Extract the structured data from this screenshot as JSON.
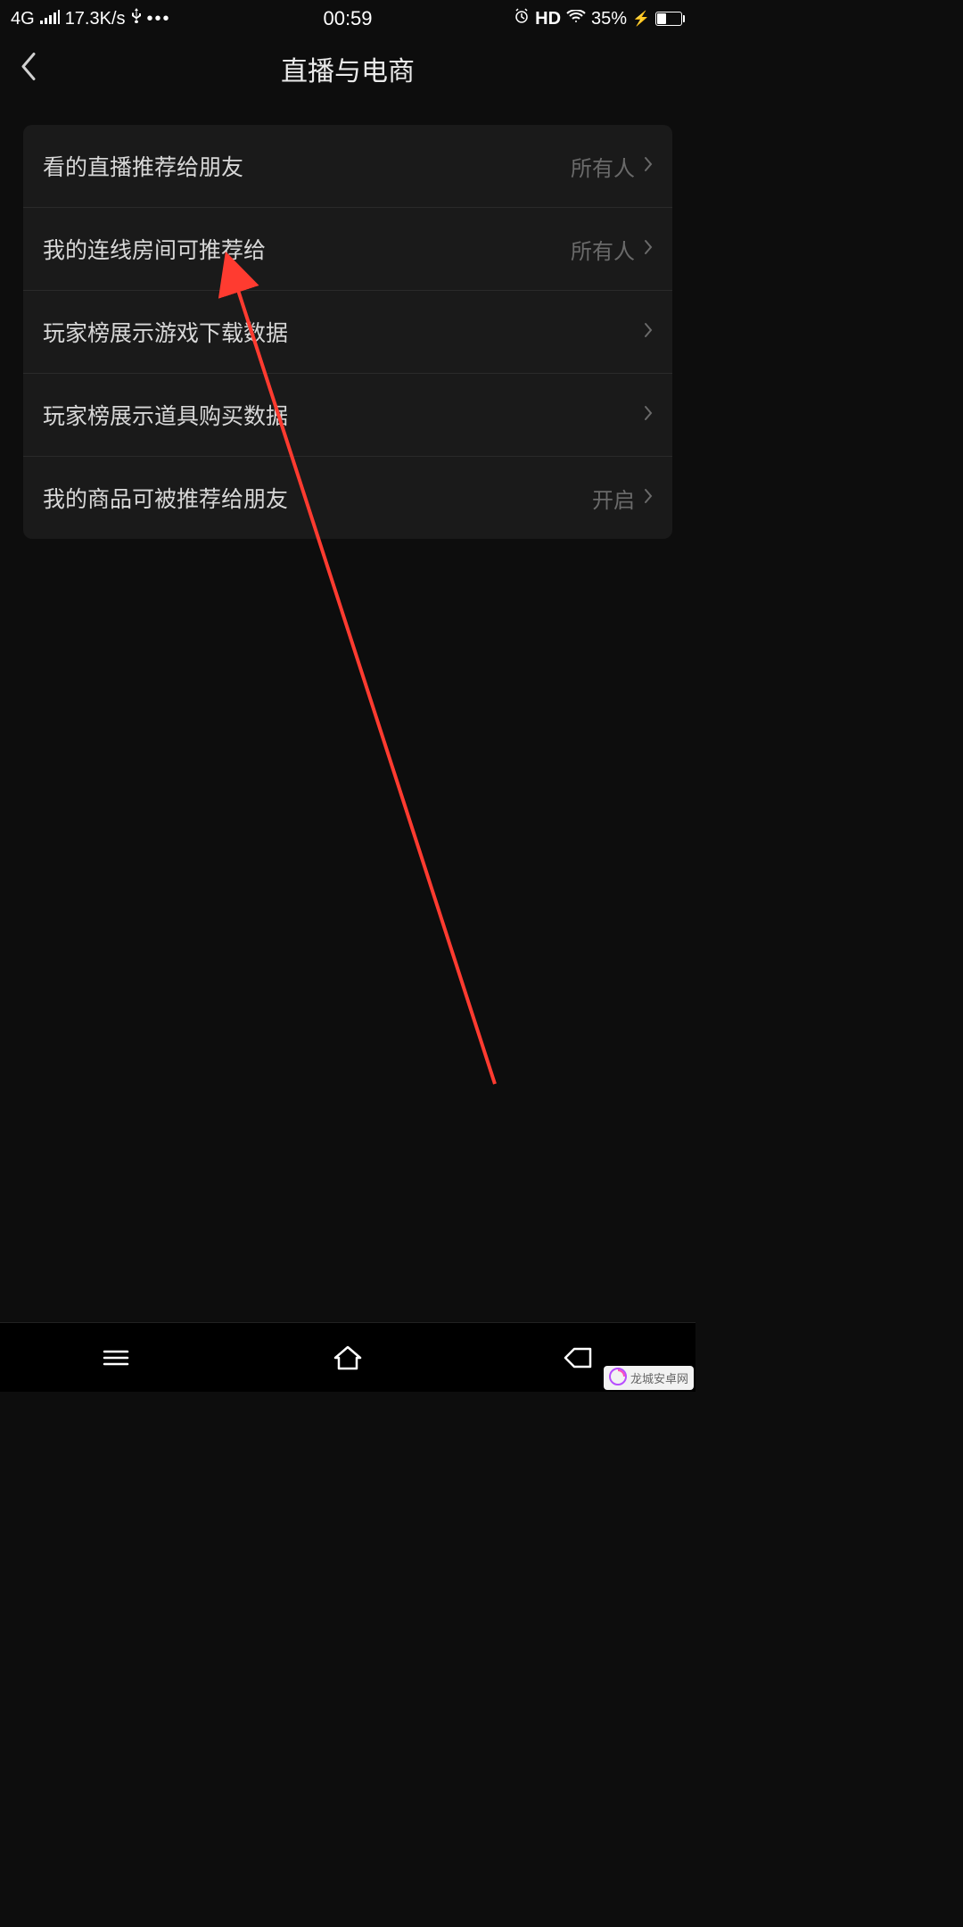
{
  "statusBar": {
    "network": "4G",
    "speed": "17.3K/s",
    "time": "00:59",
    "hd": "HD",
    "battery": "35%"
  },
  "header": {
    "title": "直播与电商"
  },
  "settings": {
    "rows": [
      {
        "label": "看的直播推荐给朋友",
        "value": "所有人"
      },
      {
        "label": "我的连线房间可推荐给",
        "value": "所有人"
      },
      {
        "label": "玩家榜展示游戏下载数据",
        "value": ""
      },
      {
        "label": "玩家榜展示道具购买数据",
        "value": ""
      },
      {
        "label": "我的商品可被推荐给朋友",
        "value": "开启"
      }
    ]
  },
  "watermark": {
    "text": "龙城安卓网"
  }
}
